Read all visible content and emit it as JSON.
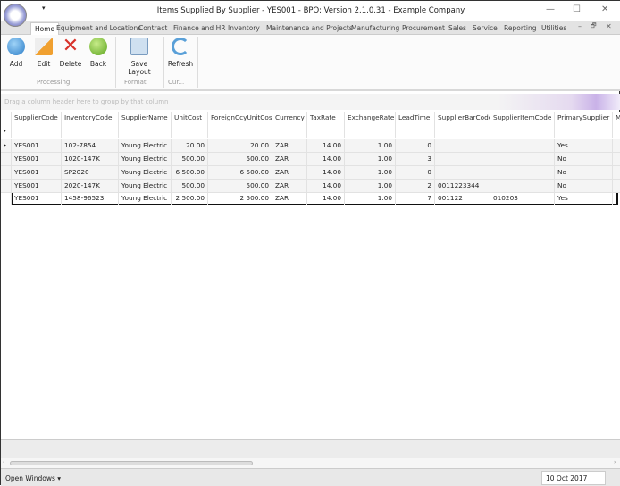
{
  "window": {
    "title": "Items Supplied By Supplier - YES001 - BPO: Version 2.1.0.31 - Example Company",
    "quick_access": "▾",
    "minimize": "—",
    "maximize": "☐",
    "close": "✕"
  },
  "tabs": [
    "Home",
    "Equipment and Locations",
    "Contract",
    "Finance and HR",
    "Inventory",
    "Maintenance and Projects",
    "Manufacturing",
    "Procurement",
    "Sales",
    "Service",
    "Reporting",
    "Utilities"
  ],
  "mdi": {
    "minimize": "–",
    "restore": "🗗",
    "close": "✕"
  },
  "ribbon": {
    "add": "Add",
    "edit": "Edit",
    "delete": "Delete",
    "back": "Back",
    "save_layout": "Save Layout",
    "refresh": "Refresh",
    "groups": {
      "processing": "Processing",
      "format": "Format",
      "current": "Cur..."
    }
  },
  "grid": {
    "group_hint": "Drag a column header here to group by that column",
    "columns": [
      "SupplierCode",
      "InventoryCode",
      "SupplierName",
      "UnitCost",
      "ForeignCcyUnitCost",
      "Currency",
      "TaxRate",
      "ExchangeRate",
      "LeadTime",
      "SupplierBarCode",
      "SupplierItemCode",
      "PrimarySupplier",
      "M"
    ],
    "rows": [
      [
        "YES001",
        "102-7854",
        "Young Electric",
        "20.00",
        "20.00",
        "ZAR",
        "14.00",
        "1.00",
        "0",
        "",
        "",
        "Yes",
        ""
      ],
      [
        "YES001",
        "1020-147K",
        "Young Electric",
        "500.00",
        "500.00",
        "ZAR",
        "14.00",
        "1.00",
        "3",
        "",
        "",
        "No",
        ""
      ],
      [
        "YES001",
        "SP2020",
        "Young Electric",
        "6 500.00",
        "6 500.00",
        "ZAR",
        "14.00",
        "1.00",
        "0",
        "",
        "",
        "No",
        ""
      ],
      [
        "YES001",
        "2020-147K",
        "Young Electric",
        "500.00",
        "500.00",
        "ZAR",
        "14.00",
        "1.00",
        "2",
        "0011223344",
        "",
        "No",
        ""
      ],
      [
        "YES001",
        "1458-96523",
        "Young Electric",
        "2 500.00",
        "2 500.00",
        "ZAR",
        "14.00",
        "1.00",
        "7",
        "001122",
        "010203",
        "Yes",
        ""
      ]
    ]
  },
  "status": {
    "open_windows": "Open Windows ▾",
    "date": "10 Oct 2017"
  }
}
